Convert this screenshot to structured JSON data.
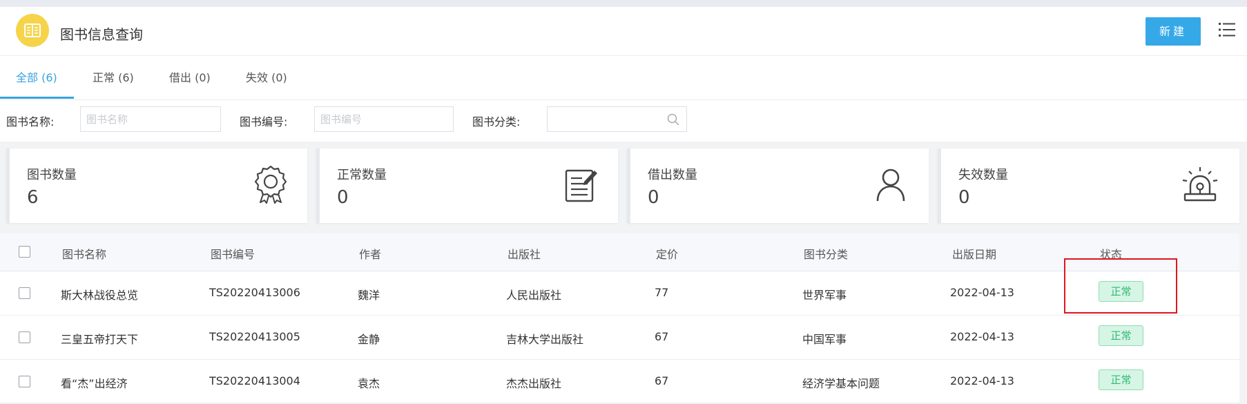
{
  "header": {
    "logo_icon": "book-icon",
    "title": "图书信息查询",
    "new_button": "新建",
    "menu_icon": "list-menu-icon"
  },
  "tabs": [
    {
      "label": "全部 (6)",
      "active": true
    },
    {
      "label": "正常 (6)",
      "active": false
    },
    {
      "label": "借出 (0)",
      "active": false
    },
    {
      "label": "失效 (0)",
      "active": false
    }
  ],
  "filters": {
    "name_label": "图书名称:",
    "name_placeholder": "图书名称",
    "code_label": "图书编号:",
    "code_placeholder": "图书编号",
    "category_label": "图书分类:",
    "category_value": "",
    "category_icon": "search-icon"
  },
  "stats": [
    {
      "title": "图书数量",
      "value": "6",
      "icon": "badge-gear-icon"
    },
    {
      "title": "正常数量",
      "value": "0",
      "icon": "edit-document-icon"
    },
    {
      "title": "借出数量",
      "value": "0",
      "icon": "user-icon"
    },
    {
      "title": "失效数量",
      "value": "0",
      "icon": "alarm-light-icon"
    }
  ],
  "table": {
    "columns": [
      "图书名称",
      "图书编号",
      "作者",
      "出版社",
      "定价",
      "图书分类",
      "出版日期",
      "状态"
    ],
    "rows": [
      {
        "name": "斯大林战役总览",
        "code": "TS20220413006",
        "author": "魏洋",
        "publisher": "人民出版社",
        "price": "77",
        "category": "世界军事",
        "date": "2022-04-13",
        "status": "正常"
      },
      {
        "name": "三皇五帝打天下",
        "code": "TS20220413005",
        "author": "金静",
        "publisher": "吉林大学出版社",
        "price": "67",
        "category": "中国军事",
        "date": "2022-04-13",
        "status": "正常"
      },
      {
        "name": "看“杰”出经济",
        "code": "TS20220413004",
        "author": "袁杰",
        "publisher": "杰杰出版社",
        "price": "67",
        "category": "经济学基本问题",
        "date": "2022-04-13",
        "status": "正常"
      }
    ]
  },
  "colors": {
    "accent": "#36a3df",
    "button": "#35a8e8",
    "logo_bg": "#f6d44a",
    "status_green": "#31bb74",
    "highlight_red": "#e0141e"
  }
}
